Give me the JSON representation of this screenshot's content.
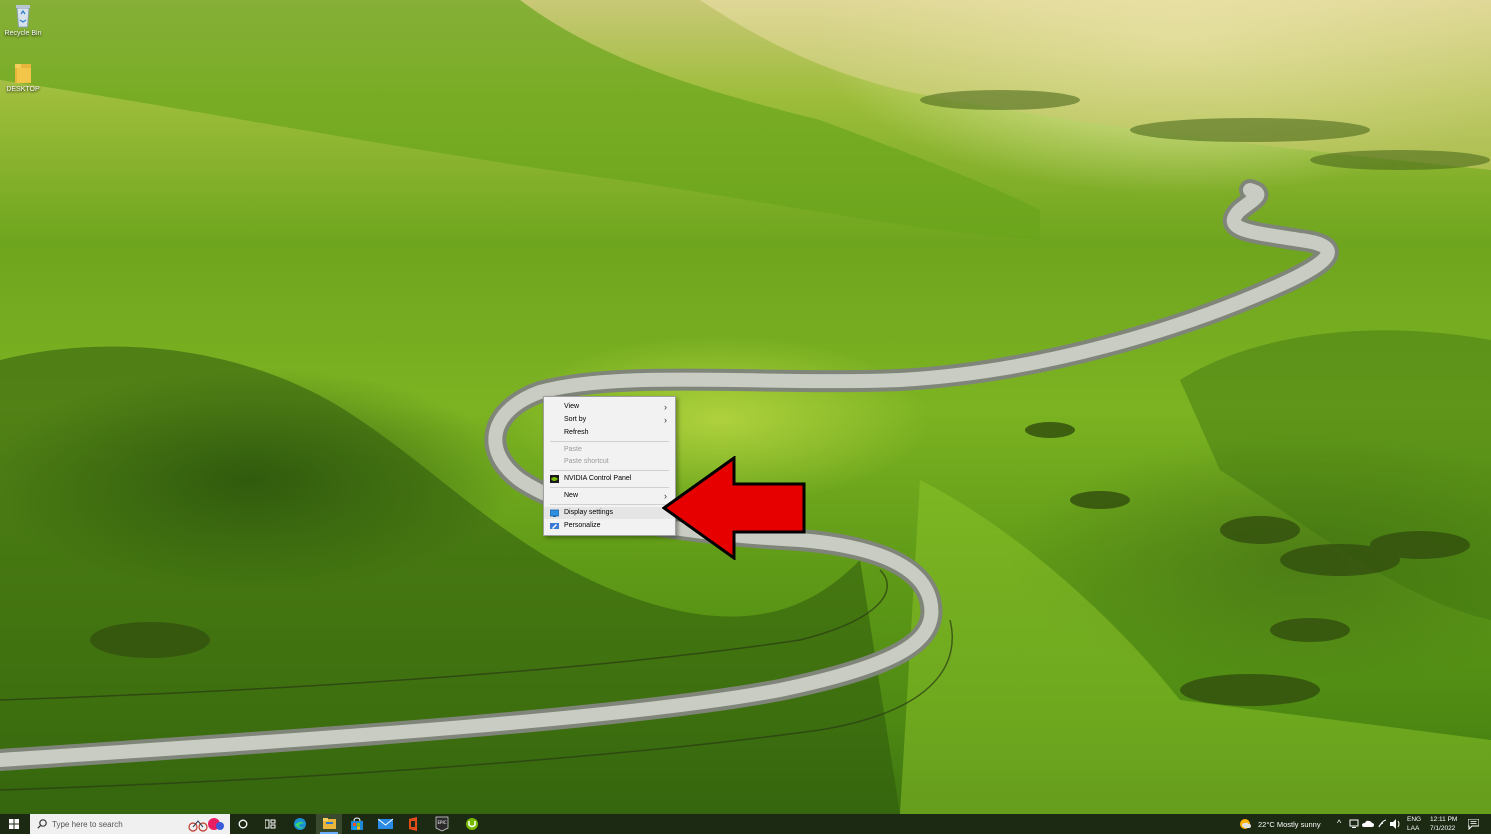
{
  "desktop": {
    "icons": [
      {
        "label": "Recycle Bin",
        "icon": "recycle-bin-icon"
      },
      {
        "label": "DESKTOP",
        "icon": "folder-icon"
      }
    ]
  },
  "context_menu": {
    "items": [
      {
        "label": "View",
        "submenu": true
      },
      {
        "label": "Sort by",
        "submenu": true
      },
      {
        "label": "Refresh"
      },
      {
        "label": "Paste",
        "disabled": true
      },
      {
        "label": "Paste shortcut",
        "disabled": true
      },
      {
        "label": "NVIDIA Control Panel",
        "icon": "nvidia-icon"
      },
      {
        "label": "New",
        "submenu": true
      },
      {
        "label": "Display settings",
        "icon": "display-icon",
        "highlighted": true
      },
      {
        "label": "Personalize",
        "icon": "personalize-icon"
      }
    ]
  },
  "taskbar": {
    "search_placeholder": "Type here to search",
    "pinned_icons": [
      "task-view-icon",
      "cortana-icon",
      "edge-icon",
      "file-explorer-icon",
      "store-icon",
      "mail-icon",
      "office-icon",
      "epic-games-icon",
      "utorrent-icon"
    ],
    "weather": "22°C  Mostly sunny",
    "language_top": "ENG",
    "language_bottom": "LAA",
    "time": "12:11 PM",
    "date": "7/1/2022"
  },
  "colors": {
    "taskbar_bg": "#1c2a14",
    "arrow": "#e00000",
    "menu_bg": "#f2f2f2",
    "menu_highlight": "#e5e5e5"
  }
}
